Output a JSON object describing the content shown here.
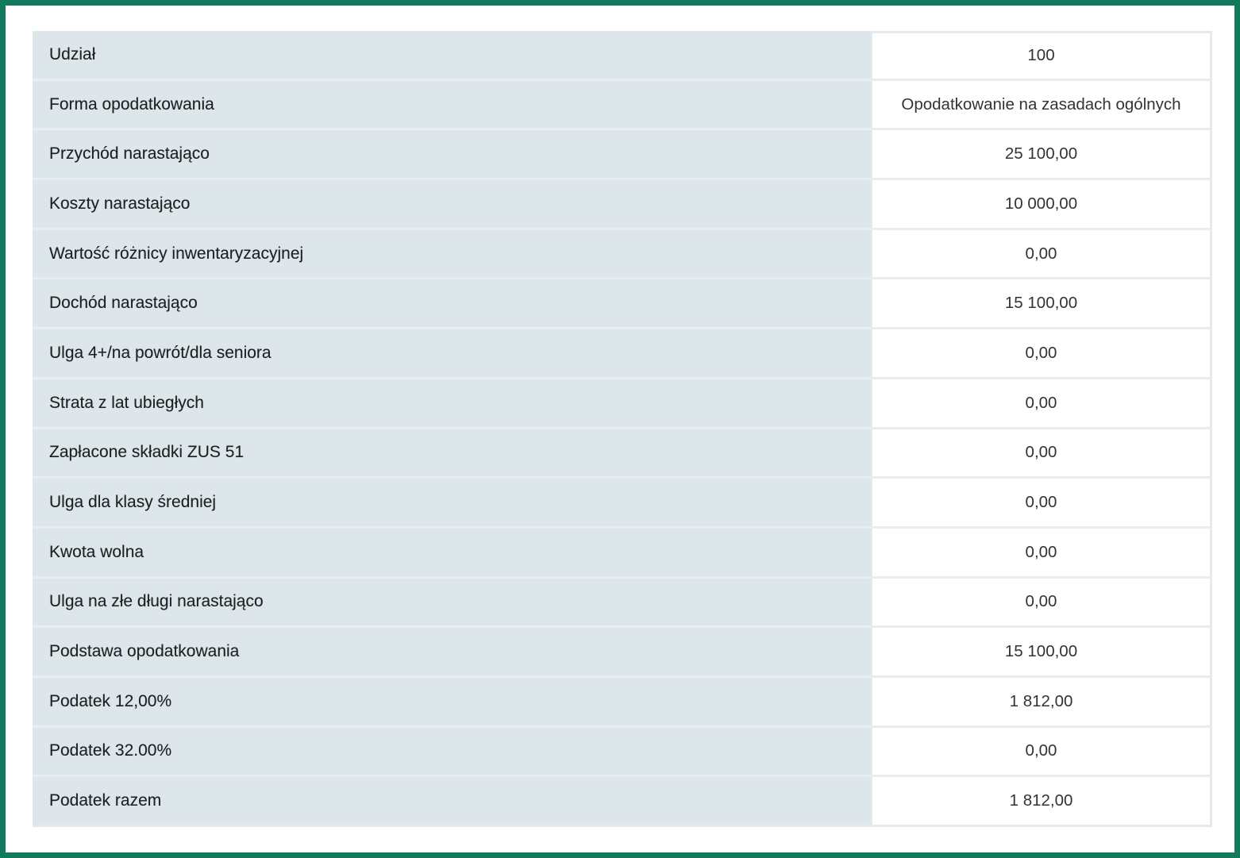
{
  "colors": {
    "frame_border": "#117a5c",
    "label_bg": "#dde6ea",
    "value_bg": "#ffffff"
  },
  "rows": [
    {
      "label": "Udział",
      "value": "100"
    },
    {
      "label": "Forma opodatkowania",
      "value": "Opodatkowanie na zasadach ogólnych"
    },
    {
      "label": "Przychód narastająco",
      "value": "25 100,00"
    },
    {
      "label": "Koszty narastająco",
      "value": "10 000,00"
    },
    {
      "label": "Wartość różnicy inwentaryzacyjnej",
      "value": "0,00"
    },
    {
      "label": "Dochód narastająco",
      "value": "15 100,00"
    },
    {
      "label": "Ulga 4+/na powrót/dla seniora",
      "value": "0,00"
    },
    {
      "label": "Strata z lat ubiegłych",
      "value": "0,00"
    },
    {
      "label": "Zapłacone składki ZUS 51",
      "value": "0,00"
    },
    {
      "label": "Ulga dla klasy średniej",
      "value": "0,00"
    },
    {
      "label": "Kwota wolna",
      "value": "0,00"
    },
    {
      "label": "Ulga na złe długi narastająco",
      "value": "0,00"
    },
    {
      "label": "Podstawa opodatkowania",
      "value": "15 100,00"
    },
    {
      "label": "Podatek 12,00%",
      "value": "1 812,00"
    },
    {
      "label": "Podatek 32.00%",
      "value": "0,00"
    },
    {
      "label": "Podatek razem",
      "value": "1 812,00"
    }
  ]
}
